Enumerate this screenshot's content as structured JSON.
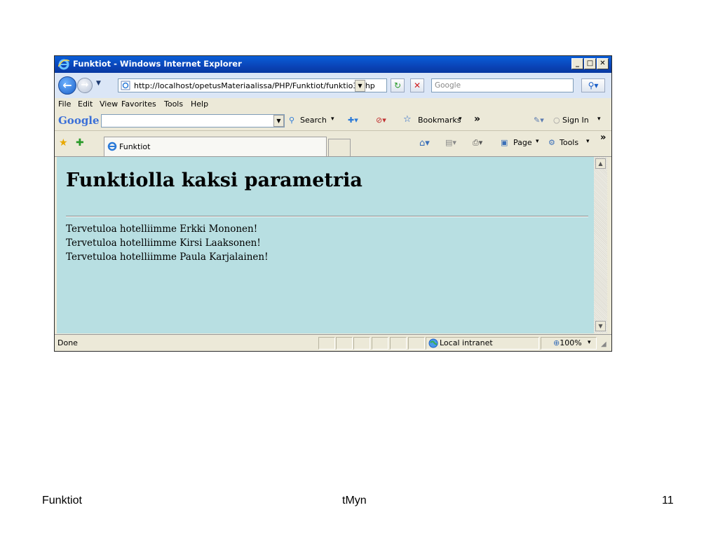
{
  "window": {
    "title": "Funktiot - Windows Internet Explorer",
    "minimize": "_",
    "maximize": "□",
    "close": "✕"
  },
  "nav": {
    "address": "http://localhost/opetusMateriaalissa/PHP/Funktiot/funktio3.php",
    "search_placeholder": "Google"
  },
  "menu": {
    "items": [
      "File",
      "Edit",
      "View",
      "Favorites",
      "Tools",
      "Help"
    ]
  },
  "google_toolbar": {
    "logo": "Google",
    "search_label": "Search",
    "bookmarks_label": "Bookmarks",
    "more_glyph": "»",
    "sign_in_label": "Sign In"
  },
  "tabs": {
    "active_tab": "Funktiot",
    "page_label": "Page",
    "tools_label": "Tools",
    "more_glyph": "»"
  },
  "page": {
    "heading": "Funktiolla kaksi parametria",
    "lines": [
      "Tervetuloa hotelliimme Erkki Mononen!",
      "Tervetuloa hotelliimme Kirsi Laaksonen!",
      "Tervetuloa hotelliimme Paula Karjalainen!"
    ]
  },
  "status": {
    "text": "Done",
    "zone": "Local intranet",
    "zoom": "100%"
  },
  "footer": {
    "left": "Funktiot",
    "center": "tMyn",
    "page_number": "11"
  },
  "icons": {
    "back": "back-arrow-icon",
    "forward": "forward-arrow-icon",
    "refresh": "refresh-icon",
    "stop": "stop-icon",
    "search": "magnifier-icon",
    "favorites": "star-icon",
    "home": "home-icon",
    "print": "printer-icon",
    "zone": "globe-icon"
  },
  "colors": {
    "titlebar": "#0a4fc8",
    "page_background": "#b8dfe2",
    "chrome": "#ece9d8"
  }
}
